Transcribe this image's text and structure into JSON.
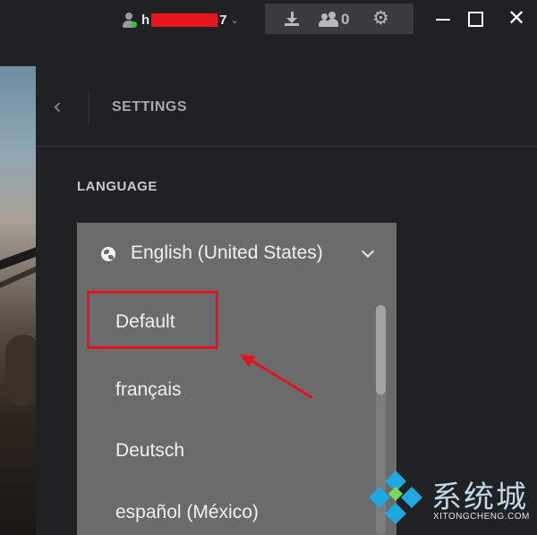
{
  "titlebar": {
    "user": {
      "name_start": "h",
      "name_end": "7",
      "status_color": "#3fbf3f",
      "redaction_color": "#e8171f"
    },
    "toolbar": {
      "friends_count": "0"
    }
  },
  "settings": {
    "title": "SETTINGS",
    "section_label": "LANGUAGE",
    "language_dropdown": {
      "selected": "English (United States)",
      "options": [
        "Default",
        "français",
        "Deutsch",
        "español (México)"
      ],
      "scroll_position": 0
    }
  },
  "annotation": {
    "highlight_color": "#e3141c",
    "highlighted_option": "Default"
  },
  "watermark": {
    "brand_cn": "系统城",
    "brand_en": "XITONGCHENG.COM"
  }
}
